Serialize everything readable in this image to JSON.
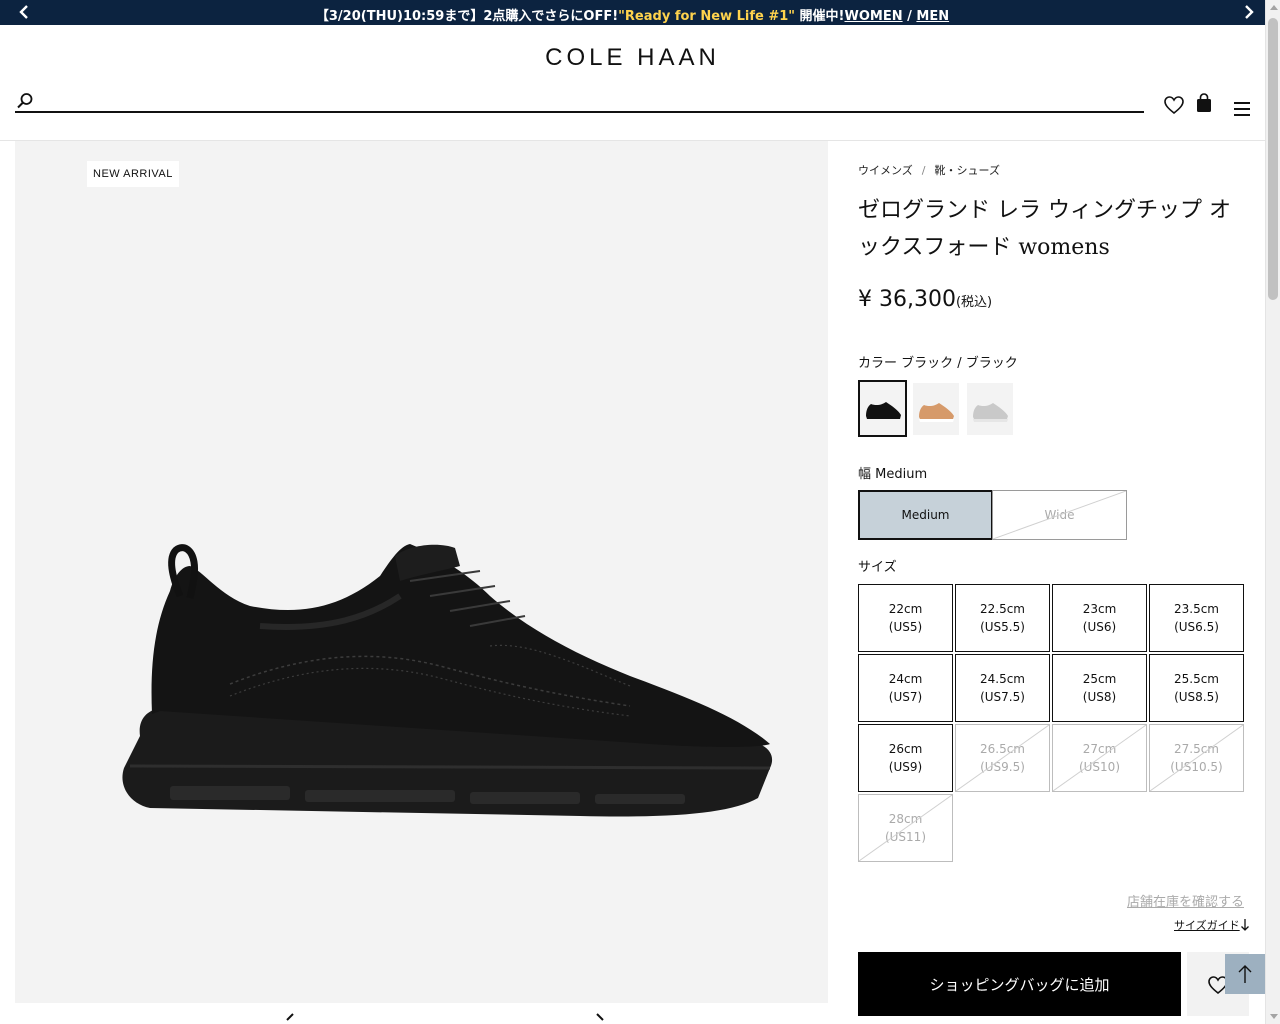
{
  "promo": {
    "text_before": "【3/20(THU)10:59まで】2点購入でさらにOFF!",
    "highlight": "\"Ready for New Life #1\"",
    "text_after": " 開催中!",
    "link_women": "WOMEN",
    "divider": " / ",
    "link_men": "MEN",
    "bg_color": "#0c2340",
    "highlight_color": "#ffd34d"
  },
  "header": {
    "logo": "COLE HAAN",
    "search_placeholder": "",
    "icons": [
      "search-icon",
      "heart-icon",
      "bag-icon",
      "menu-icon"
    ]
  },
  "gallery": {
    "badge": "NEW ARRIVAL"
  },
  "breadcrumb": {
    "items": [
      "ウイメンズ",
      "靴・シューズ"
    ],
    "separator": "/"
  },
  "product": {
    "title": "ゼログランド レラ ウィングチップ オックスフォード womens",
    "price": "¥ 36,300",
    "tax_note": "(税込)",
    "color_label": "カラー ブラック / ブラック",
    "width_label": "幅 Medium",
    "widths": [
      {
        "label": "Medium",
        "selected": true,
        "available": true
      },
      {
        "label": "Wide",
        "selected": false,
        "available": false
      }
    ],
    "size_label": "サイズ",
    "sizes": [
      {
        "cm": "22cm",
        "us": "(US5)",
        "available": true
      },
      {
        "cm": "22.5cm",
        "us": "(US5.5)",
        "available": true
      },
      {
        "cm": "23cm",
        "us": "(US6)",
        "available": true
      },
      {
        "cm": "23.5cm",
        "us": "(US6.5)",
        "available": true
      },
      {
        "cm": "24cm",
        "us": "(US7)",
        "available": true
      },
      {
        "cm": "24.5cm",
        "us": "(US7.5)",
        "available": true
      },
      {
        "cm": "25cm",
        "us": "(US8)",
        "available": true
      },
      {
        "cm": "25.5cm",
        "us": "(US8.5)",
        "available": true
      },
      {
        "cm": "26cm",
        "us": "(US9)",
        "available": true
      },
      {
        "cm": "26.5cm",
        "us": "(US9.5)",
        "available": false
      },
      {
        "cm": "27cm",
        "us": "(US10)",
        "available": false
      },
      {
        "cm": "27.5cm",
        "us": "(US10.5)",
        "available": false
      },
      {
        "cm": "28cm",
        "us": "(US11)",
        "available": false
      }
    ],
    "store_stock_link": "店舗在庫を確認する",
    "size_guide_link": "サイズガイド",
    "add_to_bag": "ショッピングバッグに追加"
  }
}
